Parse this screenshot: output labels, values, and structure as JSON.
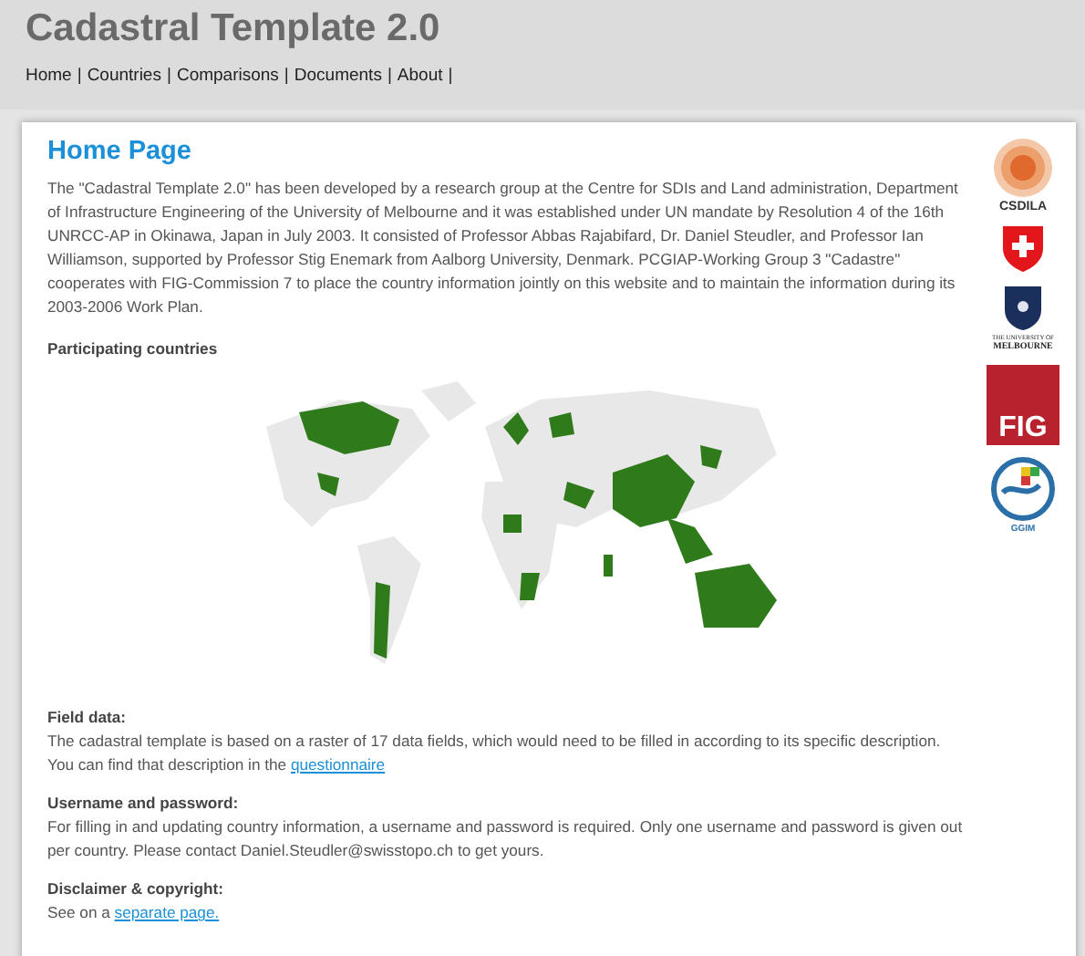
{
  "header": {
    "title": "Cadastral Template 2.0",
    "separator": "|",
    "nav": [
      {
        "label": "Home"
      },
      {
        "label": "Countries"
      },
      {
        "label": "Comparisons"
      },
      {
        "label": "Documents"
      },
      {
        "label": "About"
      }
    ]
  },
  "main": {
    "title": "Home Page",
    "intro": "The \"Cadastral Template 2.0\" has been developed by a research group at the Centre for SDIs and Land administration, Department of Infrastructure Engineering of the University of Melbourne and it was established under UN mandate by Resolution 4 of the 16th UNRCC-AP in Okinawa, Japan in July 2003. It consisted of Professor Abbas Rajabifard, Dr. Daniel Steudler, and Professor Ian Williamson, supported by Professor Stig Enemark from Aalborg University, Denmark. PCGIAP-Working Group 3 \"Cadastre\" cooperates with FIG-Commission 7 to place the country information jointly on this website and to maintain the information during its 2003-2006 Work Plan.",
    "map_heading": "Participating countries",
    "sections": [
      {
        "heading": "Field data:",
        "text": "The cadastral template is based on a raster of 17 data fields, which would need to be filled in according to its specific description. You can find that description in the ",
        "link": "questionnaire"
      },
      {
        "heading": "Username and password:",
        "text": "For filling in and updating country information, a username and password is required. Only one username and password is given out per country. Please contact Daniel.Steudler@swisstopo.ch to get yours."
      },
      {
        "heading": "Disclaimer & copyright:",
        "text": "See on a ",
        "link": "separate page."
      }
    ]
  },
  "logos": [
    {
      "kind": "csdila",
      "label": "CSDILA"
    },
    {
      "kind": "swiss"
    },
    {
      "kind": "melbourne",
      "label": "THE UNIVERSITY OF",
      "label2": "MELBOURNE"
    },
    {
      "kind": "fig",
      "label": "FIG"
    },
    {
      "kind": "ggim",
      "label": "GGIM"
    }
  ]
}
